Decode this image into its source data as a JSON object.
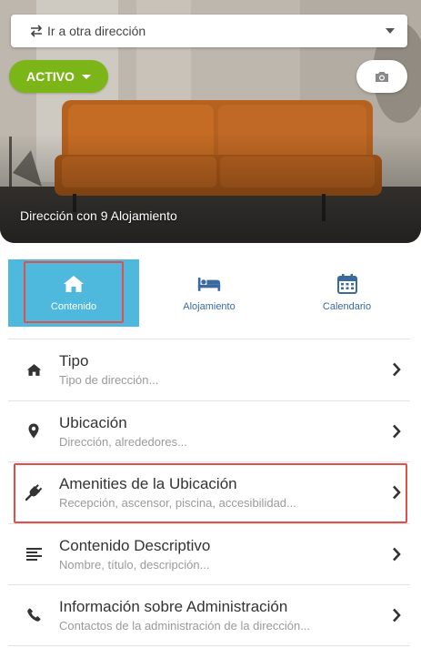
{
  "header": {
    "address_select_label": "Ir a otra dirección",
    "status_label": "ACTIVO",
    "caption": "Dirección con 9 Alojamiento"
  },
  "tabs": [
    {
      "label": "Contenido",
      "icon": "home-icon",
      "active": true
    },
    {
      "label": "Alojamiento",
      "icon": "bed-icon",
      "active": false
    },
    {
      "label": "Calendario",
      "icon": "calendar-icon",
      "active": false
    }
  ],
  "list": [
    {
      "title": "Tipo",
      "subtitle": "Tipo de dirección...",
      "icon": "home-icon"
    },
    {
      "title": "Ubicación",
      "subtitle": "Dirección, alrededores...",
      "icon": "map-pin-icon"
    },
    {
      "title": "Amenities de la Ubicación",
      "subtitle": "Recepción, ascensor, piscina, accesibilidad...",
      "icon": "plug-icon",
      "highlighted": true
    },
    {
      "title": "Contenido Descriptivo",
      "subtitle": "Nombre, título, descripción...",
      "icon": "text-align-icon"
    },
    {
      "title": "Información sobre Administración",
      "subtitle": "Contactos de la administración de la dirección...",
      "icon": "phone-icon"
    }
  ],
  "colors": {
    "accent_green": "#7cb518",
    "active_tab": "#4fb8dd",
    "tab_text": "#3b6aa0",
    "highlight_red": "#e0504f"
  }
}
